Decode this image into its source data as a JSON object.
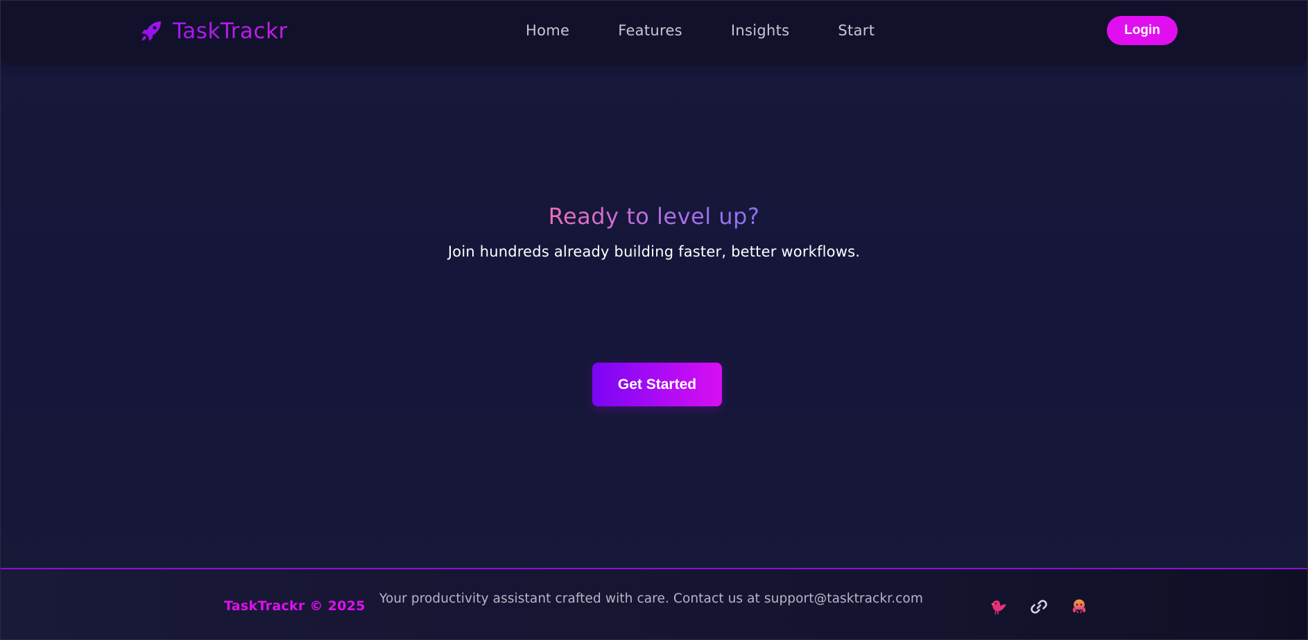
{
  "header": {
    "brand": "TaskTrackr",
    "brand_icon": "rocket-icon",
    "nav": [
      {
        "label": "Home"
      },
      {
        "label": "Features"
      },
      {
        "label": "Insights"
      },
      {
        "label": "Start"
      }
    ],
    "login_label": "Login"
  },
  "hero": {
    "title": "Ready to level up?",
    "subtitle": "Join hundreds already building faster, better workflows.",
    "cta_label": "Get Started"
  },
  "footer": {
    "brand": "TaskTrackr © 2025",
    "text": "Your productivity assistant crafted with care. Contact us at support@tasktrackr.com",
    "social_icons": [
      "bird-icon",
      "link-icon",
      "octopus-icon"
    ]
  },
  "colors": {
    "accent_magenta": "#e10ff0",
    "accent_purple": "#7a06f5",
    "background": "#16163a",
    "header_bg": "#11112b"
  }
}
